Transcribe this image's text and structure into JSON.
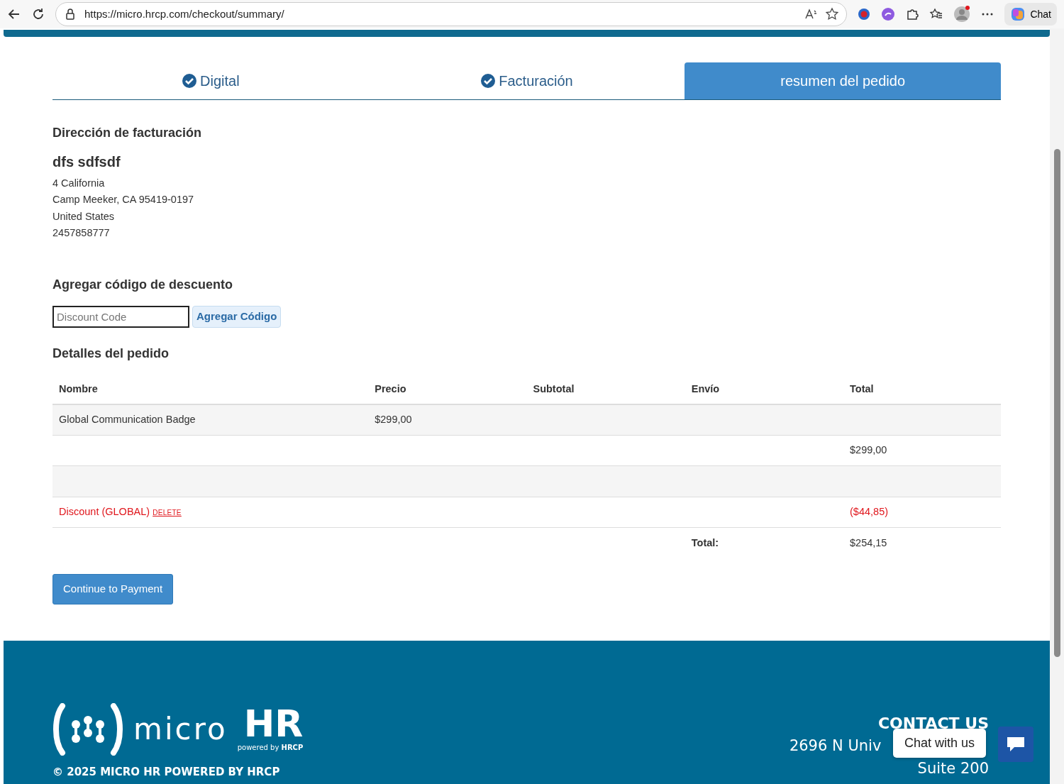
{
  "browser": {
    "url": "https://micro.hrcp.com/checkout/summary/",
    "chat_label": "Chat"
  },
  "steps": [
    {
      "label": "Digital",
      "completed": true,
      "selected": false
    },
    {
      "label": "Facturación",
      "completed": true,
      "selected": false
    },
    {
      "label": "resumen del pedido",
      "completed": false,
      "selected": true
    }
  ],
  "billing": {
    "heading": "Dirección de facturación",
    "name": "dfs sdfsdf",
    "lines": [
      "4 California",
      "Camp Meeker, CA 95419-0197",
      "United States",
      "2457858777"
    ]
  },
  "discount": {
    "heading": "Agregar código de descuento",
    "placeholder": "Discount Code",
    "button": "Agregar Código"
  },
  "order": {
    "heading": "Detalles del pedido",
    "columns": [
      "Nombre",
      "Precio",
      "Subtotal",
      "Envío",
      "Total"
    ],
    "rows": [
      {
        "kind": "item",
        "name": "Global Communication Badge",
        "price": "$299,00"
      },
      {
        "kind": "subtotal",
        "total": "$299,00"
      },
      {
        "kind": "blank"
      },
      {
        "kind": "discount",
        "name": "Discount (GLOBAL)",
        "action": "DELETE",
        "total": "($44,85)"
      },
      {
        "kind": "grand_total",
        "label": "Total:",
        "total": "$254,15"
      }
    ]
  },
  "continue_button": "Continue to Payment",
  "footer": {
    "logo_word": "micro",
    "logo_mark": "HR",
    "logo_tagline_prefix": "powered by",
    "logo_tagline_brand": "HRCP",
    "copyright": "© 2025 MICRO HR POWERED BY HRCP",
    "contact_heading": "CONTACT US",
    "address_line1": "2696 N Univ",
    "address_line2": "Suite 200"
  },
  "chat_widget": {
    "tooltip": "Chat with us"
  }
}
